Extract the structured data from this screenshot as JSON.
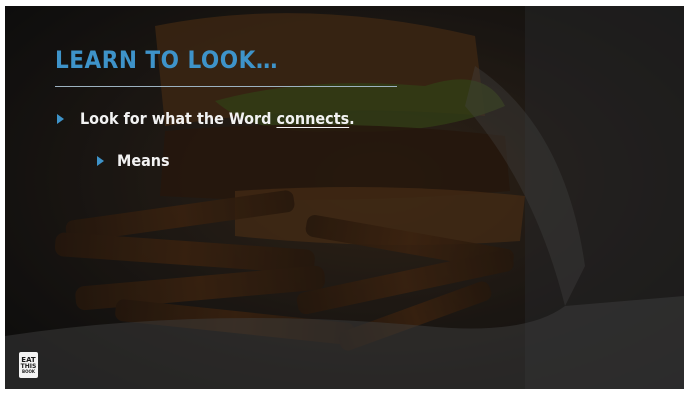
{
  "slide": {
    "title": "LEARN TO LOOK…",
    "bullets": [
      {
        "text_before": "Look for what the Word ",
        "underlined": "connects",
        "text_after": ".",
        "level": 1
      },
      {
        "text": "Means",
        "level": 2
      }
    ],
    "logo": {
      "line1": "EAT",
      "line2": "THIS",
      "line3": "BOOK"
    }
  },
  "colors": {
    "accent": "#3e93c9",
    "text": "#f2f2f2",
    "background": "#1f1d1b"
  }
}
